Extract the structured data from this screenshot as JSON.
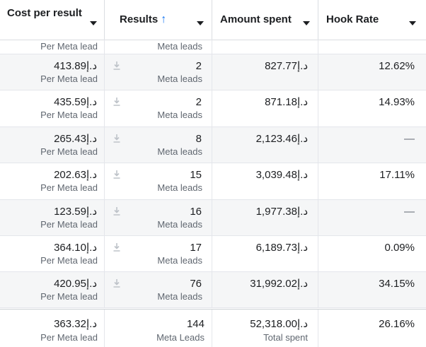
{
  "header": {
    "cost_per_result": "Cost per result",
    "results": "Results",
    "results_sort_icon": "arrow-up-icon",
    "amount_spent": "Amount spent",
    "hook_rate": "Hook Rate"
  },
  "partial_row": {
    "cost_sub": "Per Meta lead",
    "results_sub": "Meta leads"
  },
  "rows": [
    {
      "cost": "د.إ413.89",
      "cost_sub": "Per Meta lead",
      "results": "2",
      "results_sub": "Meta leads",
      "amount": "د.إ827.77",
      "hook_rate": "12.62%"
    },
    {
      "cost": "د.إ435.59",
      "cost_sub": "Per Meta lead",
      "results": "2",
      "results_sub": "Meta leads",
      "amount": "د.إ871.18",
      "hook_rate": "14.93%"
    },
    {
      "cost": "د.إ265.43",
      "cost_sub": "Per Meta lead",
      "results": "8",
      "results_sub": "Meta leads",
      "amount": "د.إ2,123.46",
      "hook_rate": "—"
    },
    {
      "cost": "د.إ202.63",
      "cost_sub": "Per Meta lead",
      "results": "15",
      "results_sub": "Meta leads",
      "amount": "د.إ3,039.48",
      "hook_rate": "17.11%"
    },
    {
      "cost": "د.إ123.59",
      "cost_sub": "Per Meta lead",
      "results": "16",
      "results_sub": "Meta leads",
      "amount": "د.إ1,977.38",
      "hook_rate": "—"
    },
    {
      "cost": "د.إ364.10",
      "cost_sub": "Per Meta lead",
      "results": "17",
      "results_sub": "Meta leads",
      "amount": "د.إ6,189.73",
      "hook_rate": "0.09%"
    },
    {
      "cost": "د.إ420.95",
      "cost_sub": "Per Meta lead",
      "results": "76",
      "results_sub": "Meta leads",
      "amount": "د.إ31,992.02",
      "hook_rate": "34.15%"
    }
  ],
  "total": {
    "cost": "د.إ363.32",
    "cost_sub": "Per Meta lead",
    "results": "144",
    "results_sub": "Meta Leads",
    "amount": "د.إ52,318.00",
    "amount_sub": "Total spent",
    "hook_rate": "26.16%"
  },
  "colors": {
    "accent": "#1877f2",
    "row_shade": "#f5f6f7",
    "muted_text": "#606770",
    "icon_gray": "#bec3c9"
  }
}
